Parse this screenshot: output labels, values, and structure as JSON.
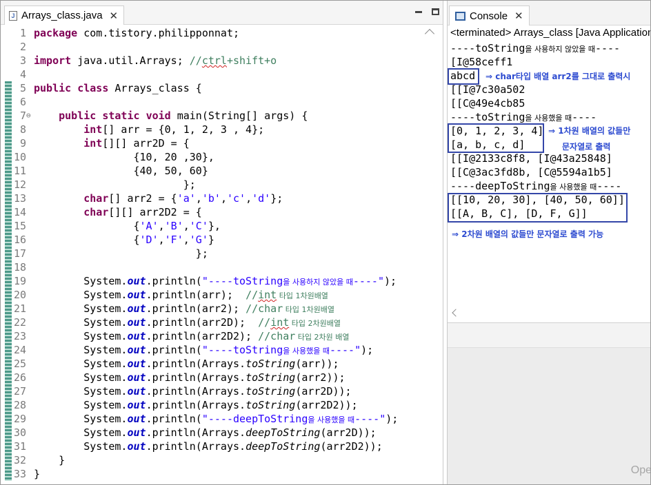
{
  "editor": {
    "tab_label": "Arrays_class.java",
    "tab_icon_letter": "J",
    "close_glyph": "✕",
    "lines": [
      {
        "n": "1",
        "t": [
          [
            "kw",
            "package"
          ],
          [
            "",
            " com.tistory.philipponnat;"
          ]
        ]
      },
      {
        "n": "2",
        "t": []
      },
      {
        "n": "3",
        "t": [
          [
            "kw",
            "import"
          ],
          [
            "",
            " java.util.Arrays; "
          ],
          [
            "cm",
            "//"
          ],
          [
            "cmsq",
            "ctrl"
          ],
          [
            "cm",
            "+shift+o"
          ]
        ]
      },
      {
        "n": "4",
        "t": []
      },
      {
        "n": "5",
        "t": [
          [
            "kw",
            "public"
          ],
          [
            "",
            " "
          ],
          [
            "kw",
            "class"
          ],
          [
            "",
            " Arrays_class {"
          ]
        ]
      },
      {
        "n": "6",
        "t": []
      },
      {
        "n": "7",
        "fold": "⊖",
        "t": [
          [
            "",
            "    "
          ],
          [
            "kw",
            "public"
          ],
          [
            "",
            " "
          ],
          [
            "kw",
            "static"
          ],
          [
            "",
            " "
          ],
          [
            "kw",
            "void"
          ],
          [
            "",
            " main(String[] args) {"
          ]
        ]
      },
      {
        "n": "8",
        "t": [
          [
            "",
            "        "
          ],
          [
            "kw",
            "int"
          ],
          [
            "",
            "[] arr = {0, 1, 2, 3 , 4};"
          ]
        ]
      },
      {
        "n": "9",
        "t": [
          [
            "",
            "        "
          ],
          [
            "kw",
            "int"
          ],
          [
            "",
            "[][] arr2D = {"
          ]
        ]
      },
      {
        "n": "10",
        "t": [
          [
            "",
            "                {10, 20 ,30},"
          ]
        ]
      },
      {
        "n": "11",
        "t": [
          [
            "",
            "                {40, 50, 60}"
          ]
        ]
      },
      {
        "n": "12",
        "t": [
          [
            "",
            "                        };"
          ]
        ]
      },
      {
        "n": "13",
        "t": [
          [
            "",
            "        "
          ],
          [
            "kw",
            "char"
          ],
          [
            "",
            "[] arr2 = {"
          ],
          [
            "st",
            "'a'"
          ],
          [
            "",
            ","
          ],
          [
            "st",
            "'b'"
          ],
          [
            "",
            ","
          ],
          [
            "st",
            "'c'"
          ],
          [
            "",
            ","
          ],
          [
            "st",
            "'d'"
          ],
          [
            "",
            "};"
          ]
        ]
      },
      {
        "n": "14",
        "t": [
          [
            "",
            "        "
          ],
          [
            "kw",
            "char"
          ],
          [
            "",
            "[][] arr2D2 = {"
          ]
        ]
      },
      {
        "n": "15",
        "t": [
          [
            "",
            "                {"
          ],
          [
            "st",
            "'A'"
          ],
          [
            "",
            ","
          ],
          [
            "st",
            "'B'"
          ],
          [
            "",
            ","
          ],
          [
            "st",
            "'C'"
          ],
          [
            "",
            "},"
          ]
        ]
      },
      {
        "n": "16",
        "t": [
          [
            "",
            "                {"
          ],
          [
            "st",
            "'D'"
          ],
          [
            "",
            ","
          ],
          [
            "st",
            "'F'"
          ],
          [
            "",
            ","
          ],
          [
            "st",
            "'G'"
          ],
          [
            "",
            "}"
          ]
        ]
      },
      {
        "n": "17",
        "t": [
          [
            "",
            "                          };"
          ]
        ]
      },
      {
        "n": "18",
        "t": []
      },
      {
        "n": "19",
        "t": [
          [
            "",
            "        System."
          ],
          [
            "fd",
            "out"
          ],
          [
            "",
            ".println("
          ],
          [
            "st",
            "\"----toString"
          ],
          [
            "stkr",
            "을 사용하지 않았을 때"
          ],
          [
            "st",
            "----\""
          ],
          [
            "",
            ");"
          ]
        ]
      },
      {
        "n": "20",
        "t": [
          [
            "",
            "        System."
          ],
          [
            "fd",
            "out"
          ],
          [
            "",
            ".println(arr);  "
          ],
          [
            "cm",
            "//"
          ],
          [
            "cmsq",
            "int"
          ],
          [
            "cmkr",
            " 타입 1차원배열"
          ]
        ]
      },
      {
        "n": "21",
        "t": [
          [
            "",
            "        System."
          ],
          [
            "fd",
            "out"
          ],
          [
            "",
            ".println(arr2); "
          ],
          [
            "cm",
            "//char"
          ],
          [
            "cmkr",
            " 타입 1차원배열"
          ]
        ]
      },
      {
        "n": "22",
        "t": [
          [
            "",
            "        System."
          ],
          [
            "fd",
            "out"
          ],
          [
            "",
            ".println(arr2D);  "
          ],
          [
            "cm",
            "//"
          ],
          [
            "cmsq",
            "int"
          ],
          [
            "cmkr",
            " 타입 2차원배열"
          ]
        ]
      },
      {
        "n": "23",
        "t": [
          [
            "",
            "        System."
          ],
          [
            "fd",
            "out"
          ],
          [
            "",
            ".println(arr2D2); "
          ],
          [
            "cm",
            "//char"
          ],
          [
            "cmkr",
            " 타입 2차원 배열"
          ]
        ]
      },
      {
        "n": "24",
        "t": [
          [
            "",
            "        System."
          ],
          [
            "fd",
            "out"
          ],
          [
            "",
            ".println("
          ],
          [
            "st",
            "\"----toString"
          ],
          [
            "stkr",
            "을 사용했을 때"
          ],
          [
            "st",
            "----\""
          ],
          [
            "",
            ");"
          ]
        ]
      },
      {
        "n": "25",
        "t": [
          [
            "",
            "        System."
          ],
          [
            "fd",
            "out"
          ],
          [
            "",
            ".println(Arrays."
          ],
          [
            "it",
            "toString"
          ],
          [
            "",
            "(arr));"
          ]
        ]
      },
      {
        "n": "26",
        "t": [
          [
            "",
            "        System."
          ],
          [
            "fd",
            "out"
          ],
          [
            "",
            ".println(Arrays."
          ],
          [
            "it",
            "toString"
          ],
          [
            "",
            "(arr2));"
          ]
        ]
      },
      {
        "n": "27",
        "t": [
          [
            "",
            "        System."
          ],
          [
            "fd",
            "out"
          ],
          [
            "",
            ".println(Arrays."
          ],
          [
            "it",
            "toString"
          ],
          [
            "",
            "(arr2D));"
          ]
        ]
      },
      {
        "n": "28",
        "t": [
          [
            "",
            "        System."
          ],
          [
            "fd",
            "out"
          ],
          [
            "",
            ".println(Arrays."
          ],
          [
            "it",
            "toString"
          ],
          [
            "",
            "(arr2D2));"
          ]
        ]
      },
      {
        "n": "29",
        "t": [
          [
            "",
            "        System."
          ],
          [
            "fd",
            "out"
          ],
          [
            "",
            ".println("
          ],
          [
            "st",
            "\"----deepToString"
          ],
          [
            "stkr",
            "을 사용했을 때"
          ],
          [
            "st",
            "----\""
          ],
          [
            "",
            ");"
          ]
        ]
      },
      {
        "n": "30",
        "t": [
          [
            "",
            "        System."
          ],
          [
            "fd",
            "out"
          ],
          [
            "",
            ".println(Arrays."
          ],
          [
            "it",
            "deepToString"
          ],
          [
            "",
            "(arr2D));"
          ]
        ]
      },
      {
        "n": "31",
        "t": [
          [
            "",
            "        System."
          ],
          [
            "fd",
            "out"
          ],
          [
            "",
            ".println(Arrays."
          ],
          [
            "it",
            "deepToString"
          ],
          [
            "",
            "(arr2D2));"
          ]
        ]
      },
      {
        "n": "32",
        "t": [
          [
            "",
            "    }"
          ]
        ]
      },
      {
        "n": "33",
        "t": [
          [
            "",
            "}"
          ]
        ]
      }
    ]
  },
  "console": {
    "tab_label": "Console",
    "close_glyph": "✕",
    "status": "<terminated> Arrays_class [Java Application",
    "lines": [
      [
        [
          "",
          "----toString"
        ],
        [
          "kr",
          "을 사용하지 않았을 때"
        ],
        [
          "",
          "----"
        ]
      ],
      [
        [
          "",
          "[I@58ceff1"
        ]
      ],
      [
        [
          "",
          "abcd"
        ]
      ],
      [
        [
          "",
          "[[I@7c30a502"
        ]
      ],
      [
        [
          "",
          "[[C@49e4cb85"
        ]
      ],
      [
        [
          "",
          "----toString"
        ],
        [
          "kr",
          "을 사용했을 때"
        ],
        [
          "",
          "----"
        ]
      ],
      [
        [
          "",
          "[0, 1, 2, 3, 4]"
        ]
      ],
      [
        [
          "",
          "[a, b, c, d]"
        ]
      ],
      [
        [
          "",
          "[[I@2133c8f8, [I@43a25848]"
        ]
      ],
      [
        [
          "",
          "[[C@3ac3fd8b, [C@5594a1b5]"
        ]
      ],
      [
        [
          "",
          "----deepToString"
        ],
        [
          "kr",
          "을 사용했을 때"
        ],
        [
          "",
          "----"
        ]
      ],
      [
        [
          "",
          "[[10, 20, 30], [40, 50, 60]]"
        ]
      ],
      [
        [
          "",
          "[[A, B, C], [D, F, G]]"
        ]
      ]
    ],
    "lower_text": "Ope"
  },
  "annotations": {
    "note_char_array": "⇒ char타입 배열 arr2를 그대로 출력시",
    "note_1d_line1": "⇒ 1차원 배열의 값들만",
    "note_1d_line2": "문자열로 출력",
    "note_2d": "⇒ 2차원 배열의 값들만 문자열로 출력 가능"
  }
}
